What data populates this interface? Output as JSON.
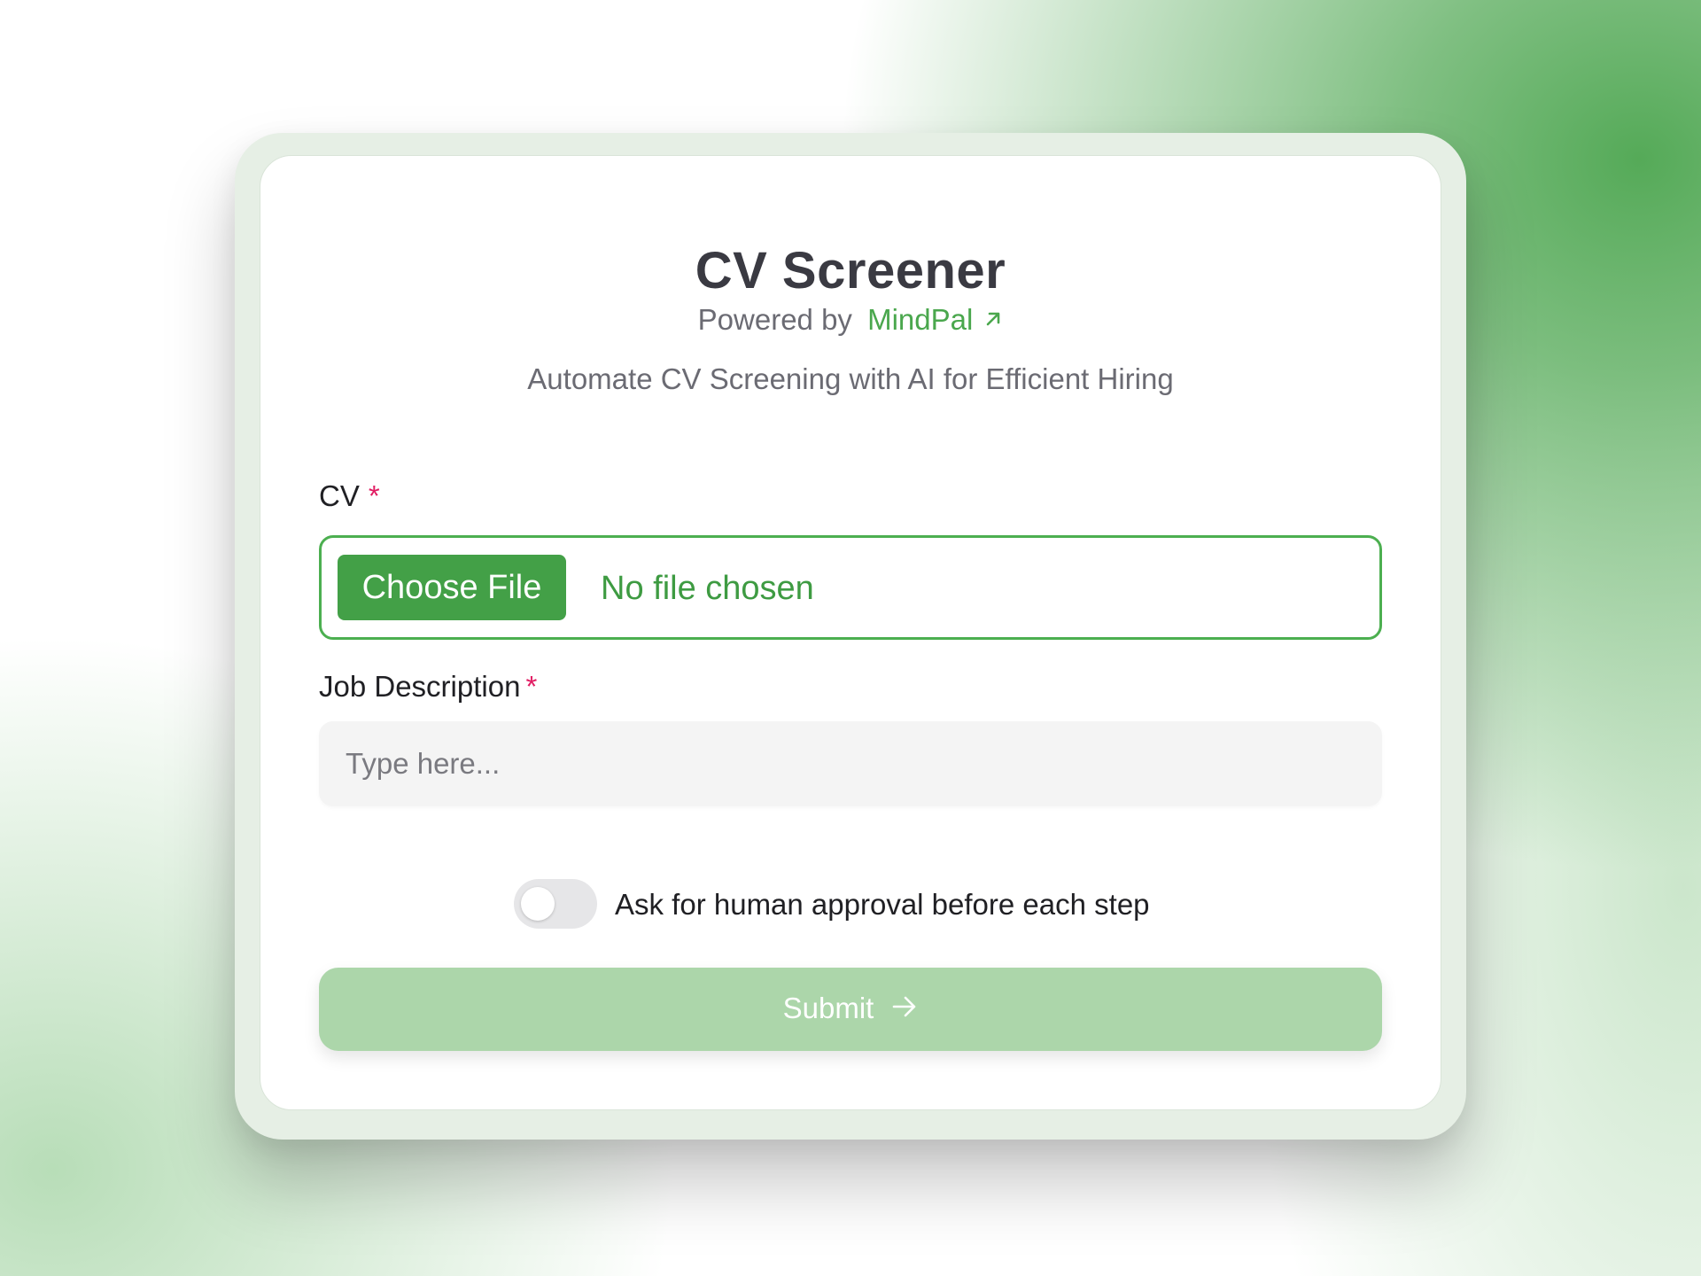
{
  "app": {
    "title": "CV Screener",
    "powered_by_prefix": "Powered by",
    "powered_by_link": "MindPal",
    "tagline": "Automate CV Screening with AI for Efficient Hiring"
  },
  "form": {
    "cv": {
      "label": "CV",
      "required_marker": "*",
      "button_label": "Choose File",
      "status": "No file chosen"
    },
    "job_description": {
      "label": "Job Description",
      "required_marker": "*",
      "placeholder": "Type here...",
      "value": ""
    },
    "approval_toggle": {
      "label": "Ask for human approval before each step",
      "checked": false
    },
    "submit_label": "Submit"
  },
  "icons": {
    "external_link": "arrow-up-right-icon",
    "submit": "arrow-right-icon"
  },
  "colors": {
    "brand_green": "#43a047",
    "link_green": "#4aa74d",
    "required": "#e11d63",
    "submit_disabled": "#acd6aa"
  }
}
